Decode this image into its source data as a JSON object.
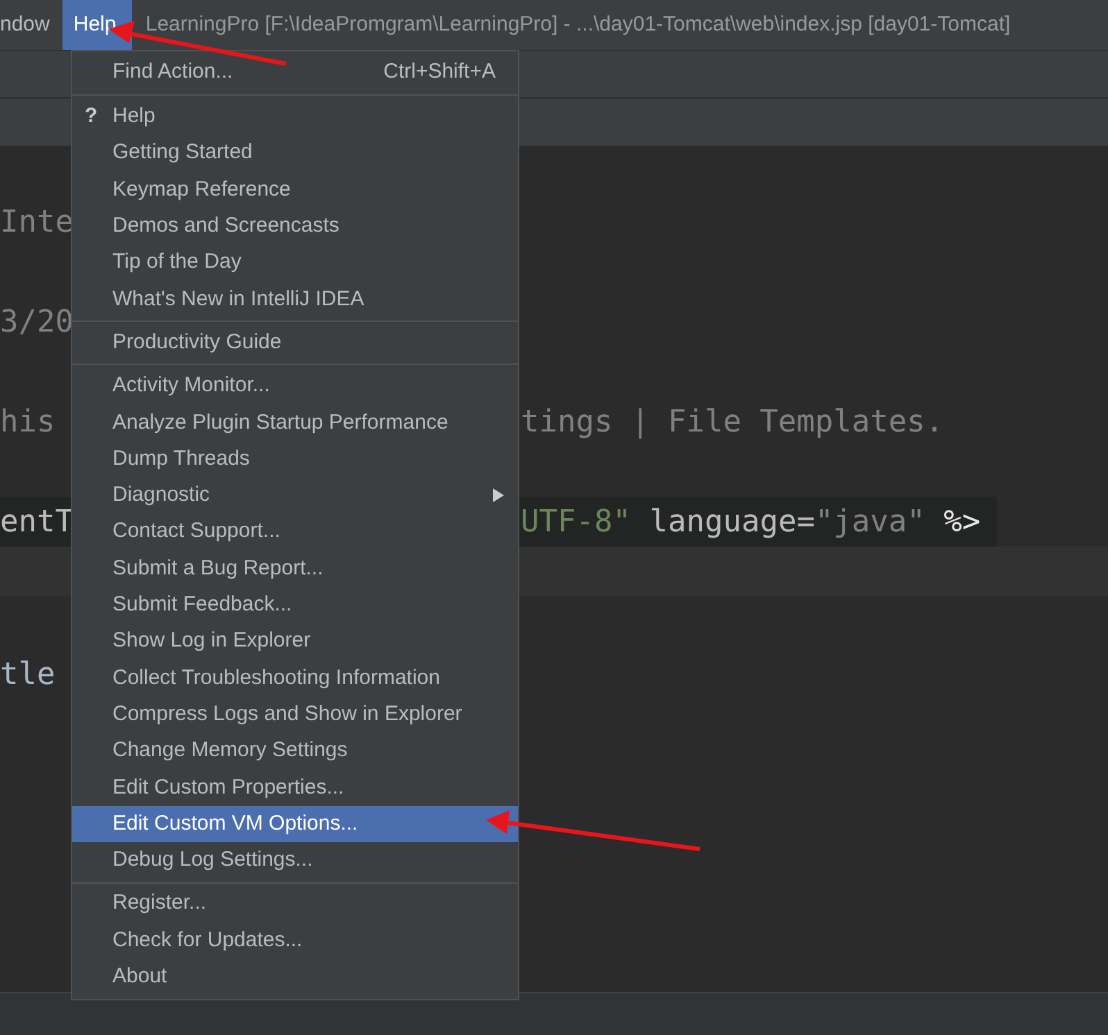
{
  "menu_bar": {
    "items": [
      {
        "label": "ndow",
        "selected": false
      },
      {
        "label": "Help",
        "selected": true
      }
    ],
    "title": "LearningPro [F:\\IdeaPromgram\\LearningPro] - ...\\day01-Tomcat\\web\\index.jsp [day01-Tomcat]"
  },
  "editor": {
    "lines": [
      {
        "left": [
          {
            "text": "Inte",
            "kind": "comment"
          }
        ]
      },
      {
        "left": [
          {
            "text": "3/20",
            "kind": "comment"
          }
        ]
      },
      {
        "left": [
          {
            "text": "his",
            "kind": "comment"
          }
        ],
        "right": [
          {
            "text": "tings | File Templates.",
            "kind": "comment"
          }
        ]
      },
      {
        "left": [
          {
            "text": "entT",
            "kind": "attr"
          }
        ],
        "right": [
          {
            "text": "UTF-8\"",
            "kind": "string"
          },
          {
            "text": " language=",
            "kind": "attr"
          },
          {
            "text": "\"java\"",
            "kind": "value"
          },
          {
            "text": " %>",
            "kind": "tag"
          }
        ]
      },
      {
        "left": [
          {
            "text": "tle",
            "kind": "name"
          }
        ]
      }
    ]
  },
  "help_menu": {
    "groups": [
      [
        {
          "label": "Find Action...",
          "shortcut": "Ctrl+Shift+A",
          "selected": false
        }
      ],
      [
        {
          "label": "Help",
          "icon": "?",
          "selected": false
        },
        {
          "label": "Getting Started",
          "selected": false
        },
        {
          "label": "Keymap Reference",
          "selected": false
        },
        {
          "label": "Demos and Screencasts",
          "selected": false
        },
        {
          "label": "Tip of the Day",
          "selected": false
        },
        {
          "label": "What's New in IntelliJ IDEA",
          "selected": false
        }
      ],
      [
        {
          "label": "Productivity Guide",
          "selected": false
        }
      ],
      [
        {
          "label": "Activity Monitor...",
          "selected": false
        },
        {
          "label": "Analyze Plugin Startup Performance",
          "selected": false
        },
        {
          "label": "Dump Threads",
          "selected": false
        },
        {
          "label": "Diagnostic",
          "submenu": true,
          "selected": false
        },
        {
          "label": "Contact Support...",
          "selected": false
        },
        {
          "label": "Submit a Bug Report...",
          "selected": false
        },
        {
          "label": "Submit Feedback...",
          "selected": false
        },
        {
          "label": "Show Log in Explorer",
          "selected": false
        },
        {
          "label": "Collect Troubleshooting Information",
          "selected": false
        },
        {
          "label": "Compress Logs and Show in Explorer",
          "selected": false
        },
        {
          "label": "Change Memory Settings",
          "selected": false
        },
        {
          "label": "Edit Custom Properties...",
          "selected": false
        },
        {
          "label": "Edit Custom VM Options...",
          "selected": true
        },
        {
          "label": "Debug Log Settings...",
          "selected": false
        }
      ],
      [
        {
          "label": "Register...",
          "selected": false
        },
        {
          "label": "Check for Updates...",
          "selected": false
        },
        {
          "label": "About",
          "selected": false
        }
      ]
    ]
  }
}
